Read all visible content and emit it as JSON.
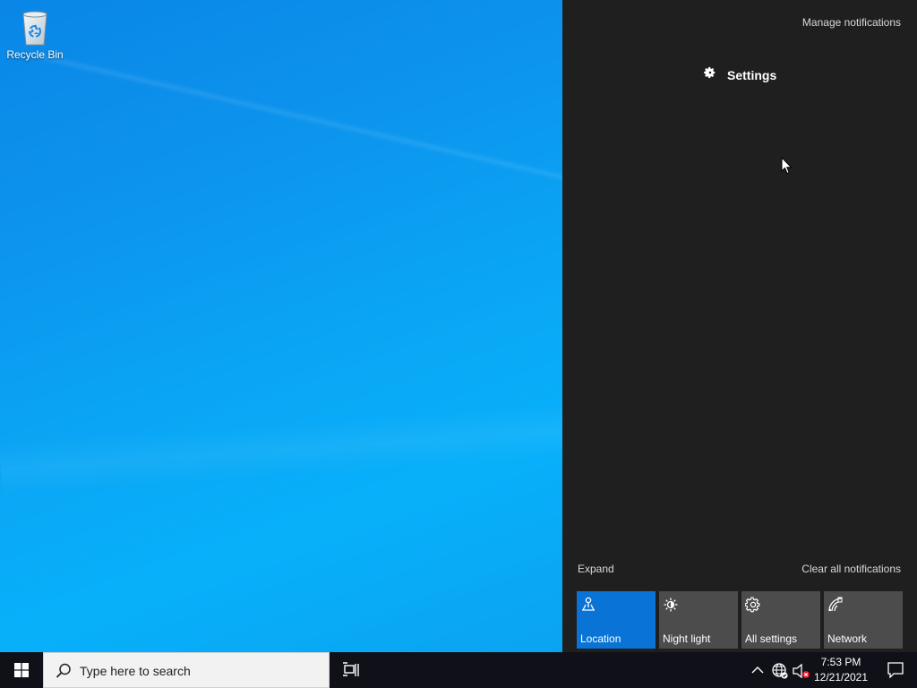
{
  "desktop": {
    "icons": [
      {
        "label": "Recycle Bin",
        "icon": "recycle-bin-icon"
      }
    ]
  },
  "action_center": {
    "manage_notifications": "Manage notifications",
    "notification_group": {
      "icon": "gear-icon",
      "title": "Settings"
    },
    "expand": "Expand",
    "clear_all": "Clear all notifications",
    "quick_actions": [
      {
        "label": "Location",
        "icon": "location-icon",
        "active": true
      },
      {
        "label": "Night light",
        "icon": "night-light-icon",
        "active": false
      },
      {
        "label": "All settings",
        "icon": "gear-icon",
        "active": false
      },
      {
        "label": "Network",
        "icon": "network-icon",
        "active": false
      }
    ]
  },
  "taskbar": {
    "start_icon": "windows-logo-icon",
    "search_placeholder": "Type here to search",
    "clock_time": "7:53 PM",
    "clock_date": "12/21/2021"
  },
  "colors": {
    "desktop_accent": "#0a9cf2",
    "action_center_bg": "#1f1f1f",
    "tile_active": "#0a74d6",
    "tile_inactive": "#4c4c4c",
    "taskbar_bg": "#101018"
  }
}
